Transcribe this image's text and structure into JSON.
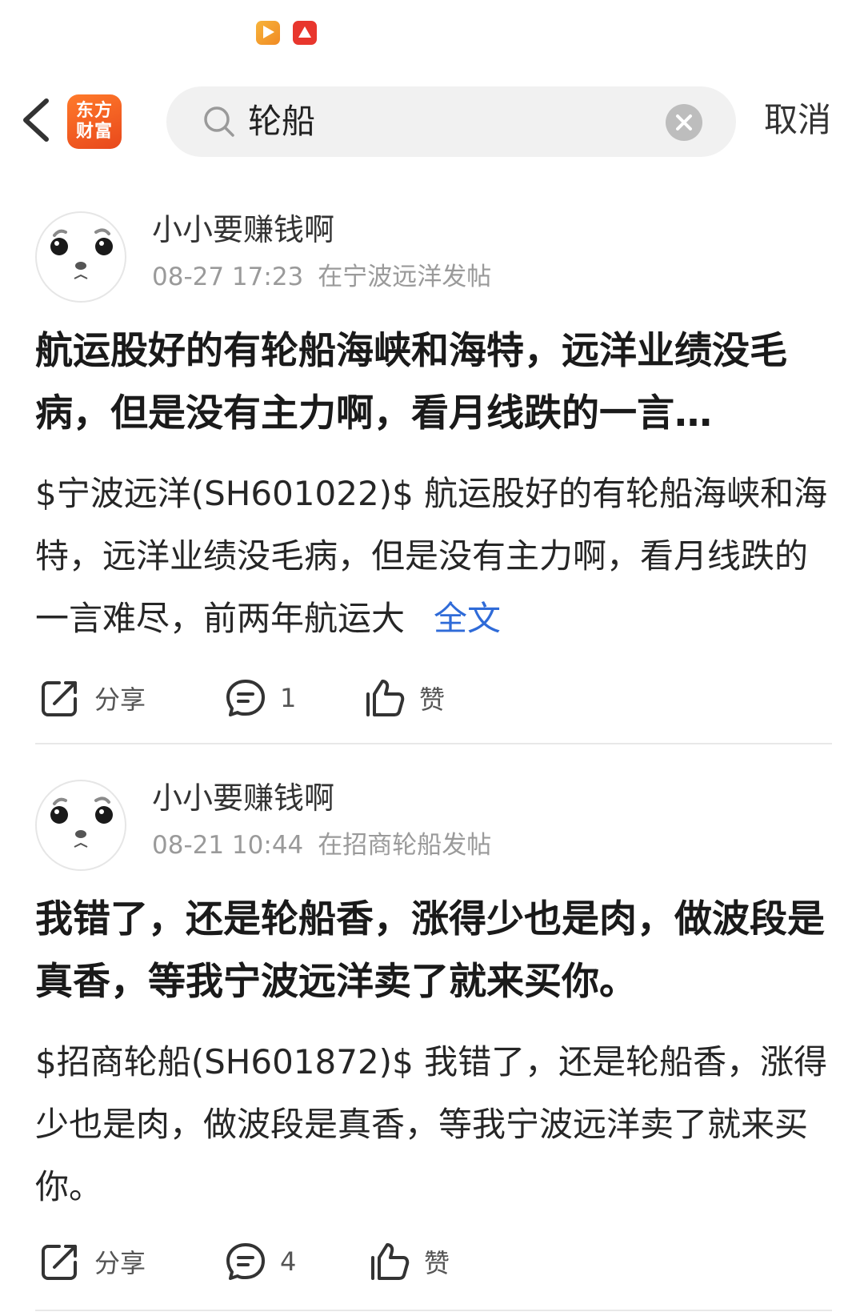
{
  "status_bar": {
    "icons": [
      "video-app-icon",
      "alert-app-icon"
    ]
  },
  "header": {
    "logo": [
      "东方",
      "财富"
    ],
    "search_value": "轮船",
    "cancel_label": "取消"
  },
  "posts": [
    {
      "author": "小小要赚钱啊",
      "time": "08-27 17:23",
      "location": "在宁波远洋发帖",
      "title": "航运股好的有轮船海峡和海特，远洋业绩没毛病，但是没有主力啊，看月线跌的一言…",
      "body": "$宁波远洋(SH601022)$ 航运股好的有轮船海峡和海特，远洋业绩没毛病，但是没有主力啊，看月线跌的一言难尽，前两年航运大",
      "more_label": "全文",
      "share_label": "分享",
      "comment_count": "1",
      "like_label": "赞"
    },
    {
      "author": "小小要赚钱啊",
      "time": "08-21 10:44",
      "location": "在招商轮船发帖",
      "title": "我错了，还是轮船香，涨得少也是肉，做波段是真香，等我宁波远洋卖了就来买你。",
      "body": "$招商轮船(SH601872)$ 我错了，还是轮船香，涨得少也是肉，做波段是真香，等我宁波远洋卖了就来买你。",
      "share_label": "分享",
      "comment_count": "4",
      "like_label": "赞"
    }
  ],
  "colors": {
    "link": "#2f6bd8",
    "logo": "#e8481c",
    "meta": "#9a9a9a"
  }
}
